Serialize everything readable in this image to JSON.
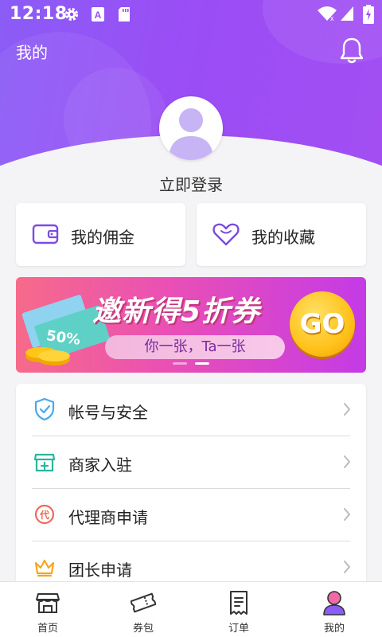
{
  "status_bar": {
    "time": "12:18",
    "icons": [
      "settings-icon",
      "font-icon",
      "sd-card-icon",
      "wifi-icon",
      "signal-icon",
      "battery-icon"
    ]
  },
  "header": {
    "title": "我的",
    "notification_icon": "bell-icon"
  },
  "profile": {
    "avatar_icon": "default-avatar-icon",
    "login_label": "立即登录"
  },
  "quick_actions": [
    {
      "label": "我的佣金",
      "icon": "wallet-icon"
    },
    {
      "label": "我的收藏",
      "icon": "heart-icon"
    }
  ],
  "banner": {
    "title": "邀新得5折券",
    "subtitle": "你一张，Ta一张",
    "go_label": "GO",
    "coupon_text": "50%",
    "slides": 2,
    "active_slide": 2
  },
  "menu": [
    {
      "label": "帐号与安全",
      "icon": "shield-check-icon"
    },
    {
      "label": "商家入驻",
      "icon": "store-icon"
    },
    {
      "label": "代理商申请",
      "icon": "agent-badge-icon",
      "icon_text": "代"
    },
    {
      "label": "团长申请",
      "icon": "crown-icon"
    }
  ],
  "tab_bar": [
    {
      "label": "首页",
      "icon": "home-store-icon",
      "active": false
    },
    {
      "label": "券包",
      "icon": "ticket-icon",
      "active": false
    },
    {
      "label": "订单",
      "icon": "order-list-icon",
      "active": false
    },
    {
      "label": "我的",
      "icon": "user-icon",
      "active": true
    }
  ],
  "colors": {
    "header_gradient_start": "#8b5cf6",
    "header_gradient_end": "#a24ef3",
    "accent_purple": "#7b4ae2",
    "banner_gradient_start": "#f76a8a",
    "banner_gradient_end": "#c43be6",
    "go_button": "#ffc21a",
    "shield_blue": "#4aa8e8",
    "store_teal": "#2bb5a0",
    "agent_red": "#ef6a5a",
    "crown_orange": "#f5a623"
  }
}
